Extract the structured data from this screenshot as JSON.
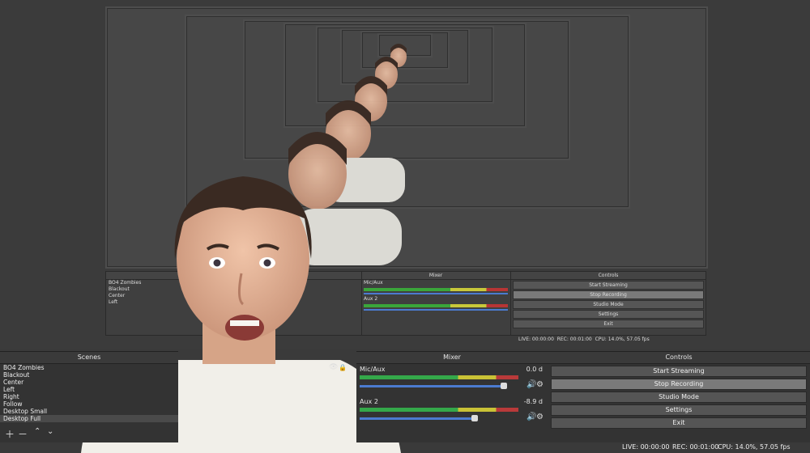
{
  "mixer_title": "Mixer",
  "scenes_title": "Scenes",
  "controls_title": "Controls",
  "scenes": [
    "BO4 Zombies",
    "Blackout",
    "Center",
    "Left",
    "Right",
    "Follow",
    "Desktop Small",
    "Desktop Full"
  ],
  "mixer": {
    "channels": [
      {
        "name": "Mic/Aux",
        "level": "0.0 d"
      },
      {
        "name": "Aux 2",
        "level": "-8.9 d"
      }
    ]
  },
  "controls": [
    "Start Streaming",
    "Stop Recording",
    "Studio Mode",
    "Settings",
    "Exit"
  ],
  "status": {
    "live": "LIVE: 00:00:00",
    "rec": "REC: 00:01:00",
    "cpu": "CPU: 14.0%, 57.05 fps"
  },
  "icons": [
    "plus-icon",
    "minus-icon",
    "chevron-up-icon",
    "chevron-down-icon",
    "eye-icon",
    "lock-icon",
    "speaker-icon",
    "gear-icon"
  ]
}
